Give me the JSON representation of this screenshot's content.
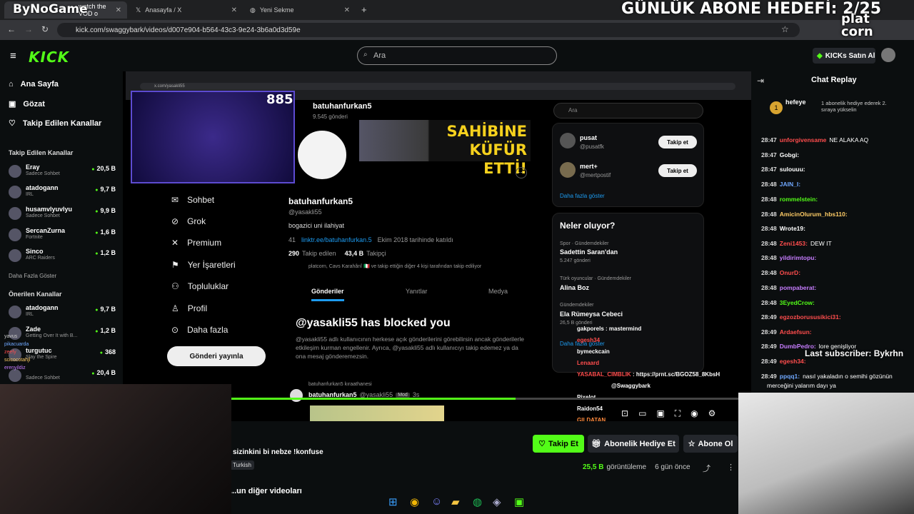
{
  "browser": {
    "tabs": [
      {
        "label": "watch the VOD o",
        "active": true
      },
      {
        "label": "Anasayfa / X",
        "active": false
      },
      {
        "label": "Yeni Sekme",
        "active": false
      }
    ],
    "url": "kick.com/swaggybark/videos/d007e904-b564-43c3-9e24-3b6a0d3d59e"
  },
  "overlay": {
    "brand_left": "ByNoGame",
    "goal": "GÜNLÜK ABONE HEDEFİ: 2/25",
    "brand_right_1": "plat",
    "brand_right_2": "corn",
    "viewer_badge": "885",
    "last_subscriber": "Last subscriber: Bykrhn"
  },
  "header": {
    "logo": "KICK",
    "search_placeholder": "Ara",
    "kicks_button": "KICKs Satın Al"
  },
  "sidebar": {
    "nav": [
      {
        "label": "Ana Sayfa",
        "icon": "home-icon"
      },
      {
        "label": "Gözat",
        "icon": "browse-icon"
      },
      {
        "label": "Takip Edilen Kanallar",
        "icon": "heart-icon"
      }
    ],
    "followed_heading": "Takip Edilen Kanallar",
    "followed": [
      {
        "name": "Eray",
        "category": "Sadece Sohbet",
        "viewers": "20,5 B"
      },
      {
        "name": "atadogann",
        "category": "IRL",
        "viewers": "9,7 B"
      },
      {
        "name": "husamvlyuvlyu",
        "category": "Sadece Sohbet",
        "viewers": "9,9 B"
      },
      {
        "name": "SercanZurna",
        "category": "Fortnite",
        "viewers": "1,6 B"
      },
      {
        "name": "Sinco",
        "category": "ARC Raiders",
        "viewers": "1,2 B"
      }
    ],
    "more": "Daha Fazla Göster",
    "recommended_heading": "Önerilen Kanallar",
    "recommended": [
      {
        "name": "atadogann",
        "category": "IRL",
        "viewers": "9,7 B"
      },
      {
        "name": "Zade",
        "category": "Getting Over It with B...",
        "viewers": "1,2 B"
      },
      {
        "name": "turgutuc",
        "category": "Slay the Spire",
        "viewers": "368"
      },
      {
        "name": "",
        "category": "Sadece Sohbet",
        "viewers": "20,4 B"
      }
    ]
  },
  "inner_x": {
    "url": "x.com/yasakli55",
    "profile_title": "batuhanfurkan5",
    "profile_posts": "9.545 gönderi",
    "nav": [
      "Sohbet",
      "Grok",
      "Premium",
      "Yer İşaretleri",
      "Topluluklar",
      "Profil",
      "Daha fazla"
    ],
    "post_button": "Gönderi yayınla",
    "banner_text": "SAHİBİNE KÜFÜR ETTİ!",
    "name": "batuhanfurkan5",
    "handle": "@yasakli55",
    "bio": "bogazici uni ilahiyat",
    "meta_location": "41",
    "meta_link": "linktr.ee/batuhanfurkan.5",
    "meta_joined": "Ekim 2018 tarihinde katıldı",
    "following_count": "290",
    "following_label": "Takip edilen",
    "followers_count": "43,4 B",
    "followers_label": "Takipçi",
    "followed_by": "platcorn, Cavs Karahânî 🇮🇹 ve takip ettiğin diğer 4 kişi tarafından takip ediliyor",
    "tabs": [
      "Gönderiler",
      "Yanıtlar",
      "Medya"
    ],
    "blocked_title": "@yasakli55 has blocked you",
    "blocked_text": "@yasakli55 adlı kullanıcının herkese açık gönderilerini görebilirsin ancak gönderilerle etkileşim kurman engellenir. Ayrıca, @yasakli55 adlı kullanıcıyı takip edemez ya da ona mesaj gönderemezsin.",
    "repost_label": "batuhanfurkan5 kıraathanesi",
    "post_author": "batuhanfurkan5",
    "post_handle": "@yasakli55",
    "post_badge": "Mod",
    "post_time": "3s",
    "right_search": "Ara",
    "suggestions": [
      {
        "name": "pusat",
        "handle": "@pusatfk",
        "button": "Takip et"
      },
      {
        "name": "mert+",
        "handle": "@mertpostif",
        "button": "Takip et"
      }
    ],
    "show_more": "Daha fazla göster",
    "trends_title": "Neler oluyor?",
    "trends": [
      {
        "category": "Spor · Gündemdekiler",
        "title": "Sadettin Saran'dan",
        "count": "5.247 gönderi"
      },
      {
        "category": "Türk oyuncular · Gündemdekiler",
        "title": "Alina Boz",
        "count": ""
      },
      {
        "category": "Gündemdekiler",
        "title": "Ela Rümeysa Cebeci",
        "count": "26,5 B gönderi"
      }
    ],
    "trends_more": "Daha fazla göster",
    "stream_chat": [
      {
        "user": "gakporels",
        "msg": "mastermind"
      },
      {
        "user": "egesh34",
        "msg": ""
      },
      {
        "user": "bymeckcain",
        "msg": ""
      },
      {
        "user": "Lenaard",
        "msg": ""
      },
      {
        "user": "YASABAL_CIMBLIK",
        "msg": "https://prnt.sc/BGOZ58_8KbsH"
      },
      {
        "user": "@Swaggybark",
        "msg": ""
      },
      {
        "user": "Pixelot",
        "msg": ""
      },
      {
        "user": "Raidon54",
        "msg": ""
      },
      {
        "user": "GILDATAN",
        "msg": ""
      }
    ]
  },
  "video": {
    "description": "sizinkini bi nebze !konfuse",
    "language_tag": "Turkish",
    "views_count": "25,5 B",
    "views_label": "görüntüleme",
    "date": "6 gün önce",
    "follow_button": "Takip Et",
    "gift_button": "Abonelik Hediye Et",
    "sub_button": "Abone Ol",
    "other_videos": "...un diğer videoları"
  },
  "left_overlay_chat": [
    {
      "user": "yavus",
      "msg": ""
    },
    {
      "user": "pikacuarda",
      "msg": ""
    },
    {
      "user": "zeefy",
      "msg": ""
    },
    {
      "user": "scicocotahjl",
      "msg": ""
    },
    {
      "user": "erenyildiz",
      "msg": ""
    }
  ],
  "chat": {
    "title": "Chat Replay",
    "pinned_user": "hefeye",
    "pinned_text": "1 abonelik hediye ederek 2. sıraya yükselin",
    "messages": [
      {
        "time": "28:47",
        "user": "unforgivensame",
        "color": "#ff4d4d",
        "msg": "NE ALAKA AQ"
      },
      {
        "time": "28:47",
        "user": "Gobgi:",
        "color": "#ffffff",
        "msg": ""
      },
      {
        "time": "28:47",
        "user": "sulouuu:",
        "color": "#ffffff",
        "msg": ""
      },
      {
        "time": "28:48",
        "user": "JAIN_I:",
        "color": "#6fa8ff",
        "msg": ""
      },
      {
        "time": "28:48",
        "user": "rommelstein:",
        "color": "#53fc18",
        "msg": ""
      },
      {
        "time": "28:48",
        "user": "AmicinOlurum_hbs110:",
        "color": "#ffcc66",
        "msg": ""
      },
      {
        "time": "28:48",
        "user": "Wrote19:",
        "color": "#ffffff",
        "msg": ""
      },
      {
        "time": "28:48",
        "user": "Zeni1453:",
        "color": "#ff4d4d",
        "msg": "DEW IT"
      },
      {
        "time": "28:48",
        "user": "yildirimtopu:",
        "color": "#c77dff",
        "msg": ""
      },
      {
        "time": "28:48",
        "user": "OnurD:",
        "color": "#ff4d4d",
        "msg": ""
      },
      {
        "time": "28:48",
        "user": "pompaberat:",
        "color": "#c77dff",
        "msg": ""
      },
      {
        "time": "28:48",
        "user": "3EyedCrow:",
        "color": "#53fc18",
        "msg": ""
      },
      {
        "time": "28:49",
        "user": "egzozborususikici31:",
        "color": "#ff4d4d",
        "msg": ""
      },
      {
        "time": "28:49",
        "user": "Ardaefsun:",
        "color": "#ff4d4d",
        "msg": ""
      },
      {
        "time": "28:49",
        "user": "DumbPedro:",
        "color": "#c77dff",
        "msg": "lore genişliyor"
      },
      {
        "time": "28:49",
        "user": "egesh34:",
        "color": "#ff4d4d",
        "msg": ""
      },
      {
        "time": "28:49",
        "user": "ppqq1:",
        "color": "#6fa8ff",
        "msg": "nasıl yakaladın o semihi gözünün"
      },
      {
        "time": "",
        "user": "",
        "color": "#ffffff",
        "msg": "merceğini yalarım dayı ya"
      }
    ]
  },
  "colors": {
    "accent": "#53fc18",
    "bg": "#0b0e0f"
  }
}
